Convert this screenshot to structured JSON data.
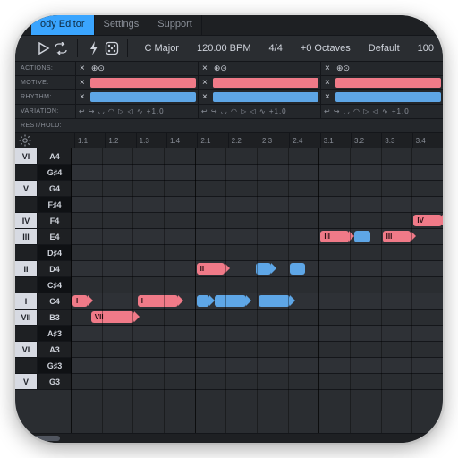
{
  "tabs": {
    "editor": "ody Editor",
    "settings": "Settings",
    "support": "Support"
  },
  "toolbar": {
    "key": "C Major",
    "bpm": "120.00 BPM",
    "sig": "4/4",
    "oct": "+0 Octaves",
    "preset": "Default",
    "len": "100"
  },
  "hdr": {
    "actions": "ACTIONS:",
    "motive": "MOTIVE:",
    "rhythm": "RHYTHM:",
    "variation": "VARIATION:",
    "rest": "REST/HOLD:",
    "varglyphs": "↩ ↪ ◡ ◠ ▷ ◁ ∿ +1.0"
  },
  "ruler": [
    "1.1",
    "1.2",
    "1.3",
    "1.4",
    "2.1",
    "2.2",
    "2.3",
    "2.4",
    "3.1",
    "3.2",
    "3.3",
    "3.4"
  ],
  "rows": [
    {
      "deg": "VI",
      "note": "A4",
      "on": true,
      "black": false
    },
    {
      "deg": "",
      "note": "G♯4",
      "on": false,
      "black": true
    },
    {
      "deg": "V",
      "note": "G4",
      "on": true,
      "black": false
    },
    {
      "deg": "",
      "note": "F♯4",
      "on": false,
      "black": true
    },
    {
      "deg": "IV",
      "note": "F4",
      "on": true,
      "black": false
    },
    {
      "deg": "III",
      "note": "E4",
      "on": true,
      "black": false
    },
    {
      "deg": "",
      "note": "D♯4",
      "on": false,
      "black": true
    },
    {
      "deg": "II",
      "note": "D4",
      "on": true,
      "black": false
    },
    {
      "deg": "",
      "note": "C♯4",
      "on": false,
      "black": true
    },
    {
      "deg": "I",
      "note": "C4",
      "on": true,
      "black": false
    },
    {
      "deg": "VII",
      "note": "B3",
      "on": true,
      "black": false
    },
    {
      "deg": "",
      "note": "A♯3",
      "on": false,
      "black": true
    },
    {
      "deg": "VI",
      "note": "A3",
      "on": true,
      "black": false
    },
    {
      "deg": "",
      "note": "G♯3",
      "on": false,
      "black": true
    },
    {
      "deg": "V",
      "note": "G3",
      "on": true,
      "black": false
    }
  ],
  "notes": [
    {
      "row": 9,
      "col": 0.0,
      "len": 0.5,
      "c": "red",
      "tag": true,
      "t": "I"
    },
    {
      "row": 10,
      "col": 0.6,
      "len": 1.4,
      "c": "red",
      "tag": true,
      "t": "VII"
    },
    {
      "row": 9,
      "col": 2.1,
      "len": 1.3,
      "c": "red",
      "tag": true,
      "t": "I"
    },
    {
      "row": 7,
      "col": 4.0,
      "len": 0.9,
      "c": "red",
      "tag": true,
      "t": "II"
    },
    {
      "row": 9,
      "col": 4.0,
      "len": 0.4,
      "c": "blue",
      "tag": true,
      "t": ""
    },
    {
      "row": 9,
      "col": 4.6,
      "len": 1.0,
      "c": "blue",
      "tag": true,
      "t": ""
    },
    {
      "row": 7,
      "col": 5.9,
      "len": 0.5,
      "c": "blue",
      "tag": true,
      "t": ""
    },
    {
      "row": 9,
      "col": 6.0,
      "len": 1.0,
      "c": "blue",
      "tag": true,
      "t": ""
    },
    {
      "row": 7,
      "col": 7.0,
      "len": 0.5,
      "c": "blue",
      "tag": false,
      "t": ""
    },
    {
      "row": 5,
      "col": 8.0,
      "len": 0.9,
      "c": "red",
      "tag": true,
      "t": "III"
    },
    {
      "row": 5,
      "col": 9.1,
      "len": 0.5,
      "c": "blue",
      "tag": false,
      "t": ""
    },
    {
      "row": 5,
      "col": 10.0,
      "len": 0.9,
      "c": "red",
      "tag": true,
      "t": "III"
    },
    {
      "row": 4,
      "col": 11.0,
      "len": 0.9,
      "c": "red",
      "tag": true,
      "t": "IV"
    }
  ],
  "segments": 3,
  "segctrl": {
    "x": "×",
    "plus": "⊕⊙"
  }
}
